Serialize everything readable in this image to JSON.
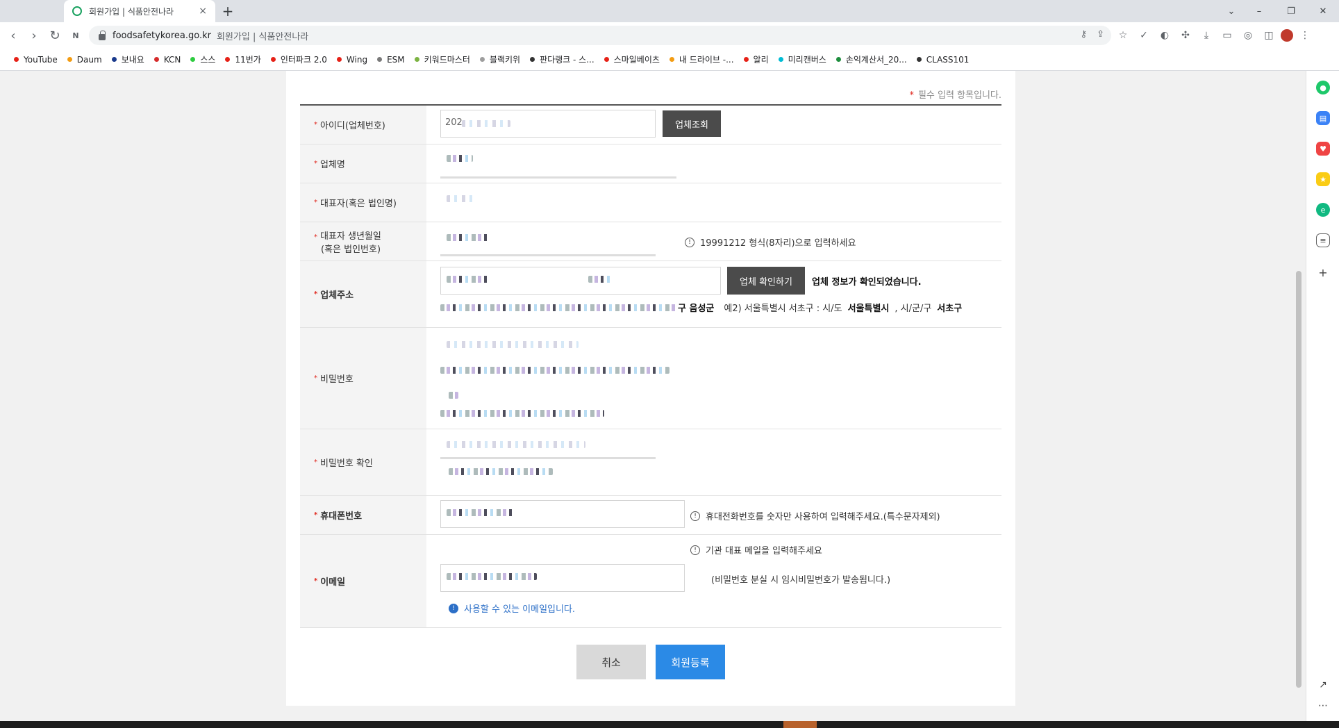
{
  "browser": {
    "tab_title": "회원가입 | 식품안전나라",
    "tab_close": "×",
    "new_tab": "+",
    "url_domain": "foodsafetykorea.go.kr",
    "url_title": "회원가입 | 식품안전나라",
    "window_controls": [
      "⌄",
      "–",
      "❐",
      "✕"
    ],
    "bookmarks": [
      {
        "label": "YouTube",
        "color": "#e62117"
      },
      {
        "label": "Daum",
        "color": "#f39c12"
      },
      {
        "label": "보내요",
        "color": "#1a3a8c"
      },
      {
        "label": "KCN",
        "color": "#d62b2b"
      },
      {
        "label": "스스",
        "color": "#2ecc40"
      },
      {
        "label": "11번가",
        "color": "#e62117"
      },
      {
        "label": "인터파크 2.0",
        "color": "#e62117"
      },
      {
        "label": "Wing",
        "color": "#e62117"
      },
      {
        "label": "ESM",
        "color": "#7a7a7a"
      },
      {
        "label": "키워드마스터",
        "color": "#7cb342"
      },
      {
        "label": "블랙키위",
        "color": "#9e9e9e"
      },
      {
        "label": "판다랭크 - 스...",
        "color": "#333333"
      },
      {
        "label": "스마일베이츠",
        "color": "#e62117"
      },
      {
        "label": "내 드라이브 -...",
        "color": "#f39c12"
      },
      {
        "label": "알리",
        "color": "#e62117"
      },
      {
        "label": "미리캔버스",
        "color": "#00bcd4"
      },
      {
        "label": "손익계산서_20...",
        "color": "#1e8e3e"
      },
      {
        "label": "CLASS101",
        "color": "#333333"
      }
    ]
  },
  "form": {
    "required_note": "필수 입력 항목입니다.",
    "required_star": "*",
    "fields": {
      "id_label": "아이디(업체번호)",
      "id_value": "202",
      "id_button": "업체조회",
      "company_label": "업체명",
      "ceo_label": "대표자(혹은 법인명)",
      "birth_label_1": "대표자 생년월일",
      "birth_label_2": "(혹은 법인번호)",
      "birth_hint": "19991212 형식(8자리)으로 입력하세요",
      "address_label": "업체주소",
      "address_button": "업체 확인하기",
      "address_confirmed": "업체 정보가 확인되었습니다.",
      "address_example_1": "구 음성군",
      "address_example_2_prefix": "예2) 서울특별시 서초구 : 시/도",
      "address_example_2_city": "서울특별시",
      "address_example_2_mid": ", 시/군/구",
      "address_example_2_gu": "서초구",
      "password_label": "비밀번호",
      "password_confirm_label": "비밀번호 확인",
      "phone_label": "휴대폰번호",
      "phone_hint": "휴대전화번호를 숫자만 사용하여 입력해주세요.(특수문자제외)",
      "email_label": "이메일",
      "email_hint": "기관 대표 메일을 입력해주세요",
      "email_note": "(비밀번호 분실 시 임시비밀번호가 발송됩니다.)",
      "email_ok": "사용할 수 있는 이메일입니다."
    },
    "buttons": {
      "cancel": "취소",
      "submit": "회원등록"
    }
  }
}
